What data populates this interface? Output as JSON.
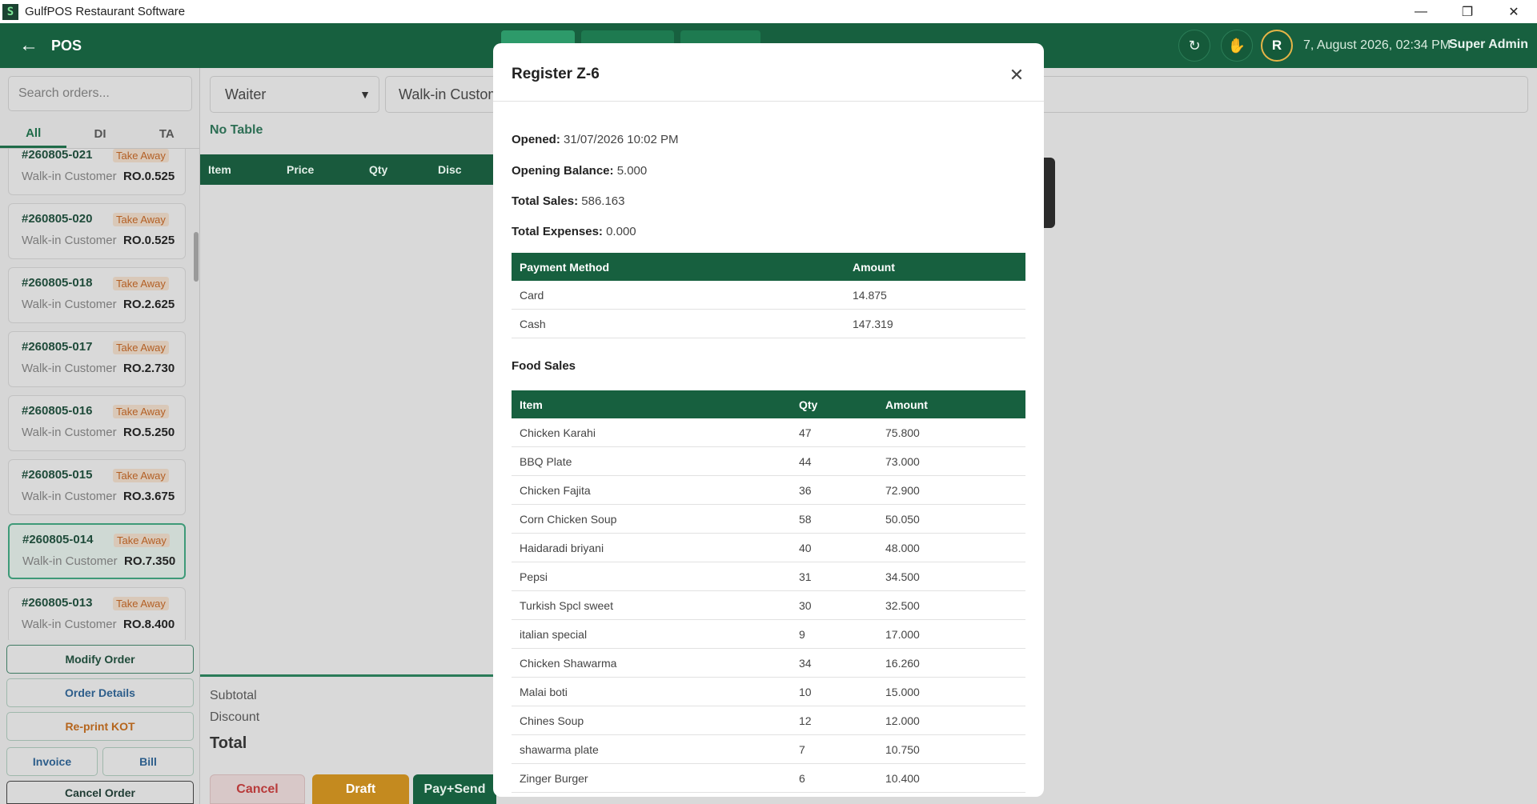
{
  "window": {
    "title": "GulfPOS Restaurant Software",
    "logo_text": "S",
    "min_icon": "—",
    "restore_icon": "❐",
    "close_icon": "✕"
  },
  "header": {
    "back_icon": "←",
    "title": "POS",
    "refresh_icon": "↻",
    "hand_icon": "✋",
    "avatar_initial": "R",
    "datetime": "7, August 2026, 02:34 PM",
    "user": "Super Admin"
  },
  "sidebar": {
    "search_placeholder": "Search orders...",
    "tabs": [
      "All",
      "DI",
      "TA"
    ],
    "orders": [
      {
        "no": "#260805-021",
        "type": "Take Away",
        "customer": "Walk-in Customer",
        "amount": "RO.0.525"
      },
      {
        "no": "#260805-020",
        "type": "Take Away",
        "customer": "Walk-in Customer",
        "amount": "RO.0.525"
      },
      {
        "no": "#260805-018",
        "type": "Take Away",
        "customer": "Walk-in Customer",
        "amount": "RO.2.625"
      },
      {
        "no": "#260805-017",
        "type": "Take Away",
        "customer": "Walk-in Customer",
        "amount": "RO.2.730"
      },
      {
        "no": "#260805-016",
        "type": "Take Away",
        "customer": "Walk-in Customer",
        "amount": "RO.5.250"
      },
      {
        "no": "#260805-015",
        "type": "Take Away",
        "customer": "Walk-in Customer",
        "amount": "RO.3.675"
      },
      {
        "no": "#260805-014",
        "type": "Take Away",
        "customer": "Walk-in Customer",
        "amount": "RO.7.350"
      },
      {
        "no": "#260805-013",
        "type": "Take Away",
        "customer": "Walk-in Customer",
        "amount": "RO.8.400"
      }
    ],
    "buttons": {
      "modify": "Modify Order",
      "details": "Order Details",
      "reprint": "Re-print KOT",
      "invoice": "Invoice",
      "bill": "Bill",
      "cancel": "Cancel Order"
    }
  },
  "main": {
    "waiter_label": "Waiter",
    "customer_label": "Walk-in Custom",
    "no_table": "No Table",
    "cart_columns": [
      "Item",
      "Price",
      "Qty",
      "Disc"
    ],
    "subtotal_label": "Subtotal",
    "discount_label": "Discount",
    "total_label": "Total",
    "actions": {
      "cancel": "Cancel",
      "draft": "Draft",
      "pay_send": "Pay+Send"
    }
  },
  "modal": {
    "title": "Register Z-6",
    "close_icon": "✕",
    "opened_label": "Opened:",
    "opened_value": "31/07/2026 10:02 PM",
    "opening_balance_label": "Opening Balance:",
    "opening_balance_value": "5.000",
    "total_sales_label": "Total Sales:",
    "total_sales_value": "586.163",
    "total_expenses_label": "Total Expenses:",
    "total_expenses_value": "0.000",
    "payment_columns": [
      "Payment Method",
      "Amount"
    ],
    "payments": [
      {
        "method": "Card",
        "amount": "14.875"
      },
      {
        "method": "Cash",
        "amount": "147.319"
      }
    ],
    "food_sales_title": "Food Sales",
    "food_columns": [
      "Item",
      "Qty",
      "Amount"
    ],
    "food_sales": [
      {
        "item": "Chicken Karahi",
        "qty": "47",
        "amount": "75.800"
      },
      {
        "item": "BBQ Plate",
        "qty": "44",
        "amount": "73.000"
      },
      {
        "item": "Chicken Fajita",
        "qty": "36",
        "amount": "72.900"
      },
      {
        "item": "Corn Chicken Soup",
        "qty": "58",
        "amount": "50.050"
      },
      {
        "item": "Haidaradi briyani",
        "qty": "40",
        "amount": "48.000"
      },
      {
        "item": "Pepsi",
        "qty": "31",
        "amount": "34.500"
      },
      {
        "item": "Turkish Spcl sweet",
        "qty": "30",
        "amount": "32.500"
      },
      {
        "item": "italian special",
        "qty": "9",
        "amount": "17.000"
      },
      {
        "item": "Chicken Shawarma",
        "qty": "34",
        "amount": "16.260"
      },
      {
        "item": "Malai boti",
        "qty": "10",
        "amount": "15.000"
      },
      {
        "item": "Chines Soup",
        "qty": "12",
        "amount": "12.000"
      },
      {
        "item": "shawarma plate",
        "qty": "7",
        "amount": "10.750"
      },
      {
        "item": "Zinger Burger",
        "qty": "6",
        "amount": "10.400"
      }
    ]
  }
}
